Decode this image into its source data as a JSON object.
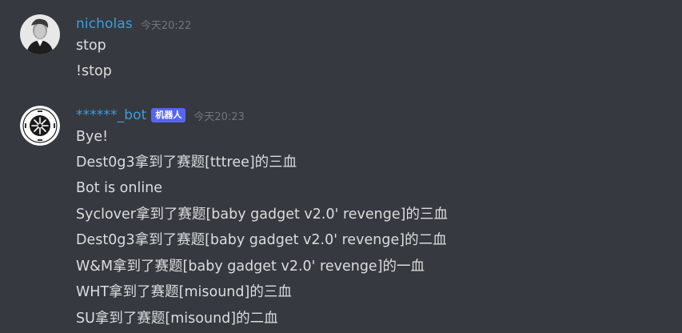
{
  "colors": {
    "background": "#36393f",
    "username_color": "#3e9ddc",
    "bot_tag_bg": "#5865f2",
    "message_text": "#dcddde",
    "timestamp": "#72767d"
  },
  "messages": [
    {
      "author": "nicholas",
      "timestamp": "今天20:22",
      "avatar_icon": "user-portrait-avatar",
      "lines": [
        "stop",
        "!stop"
      ]
    },
    {
      "author": "******_bot",
      "bot_tag": "机器人",
      "timestamp": "今天20:23",
      "avatar_icon": "bot-seal-avatar",
      "lines": [
        "Bye!",
        "Dest0g3拿到了赛题[tttree]的三血",
        "Bot is online",
        "Syclover拿到了赛题[baby gadget v2.0' revenge]的三血",
        "Dest0g3拿到了赛题[baby gadget v2.0' revenge]的二血",
        "W&M拿到了赛题[baby gadget v2.0' revenge]的一血",
        "WHT拿到了赛题[misound]的三血",
        "SU拿到了赛题[misound]的二血"
      ]
    }
  ]
}
